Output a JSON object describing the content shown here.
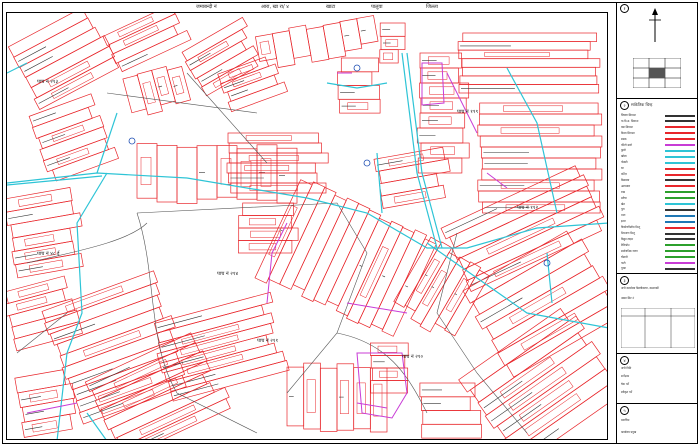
{
  "header": {
    "labels": [
      "जमाबन्दी नं",
      "आरा, खा रा/ ४",
      "खाटा",
      "पालुवा",
      "जिल्ला"
    ]
  },
  "map": {
    "labels": [
      {
        "text": "पाच नं ४८ ई"
      },
      {
        "text": "पाच नं २१४"
      },
      {
        "text": "पाच नं २११"
      },
      {
        "text": "पाच नं २१०"
      },
      {
        "text": "पाच नं ११२"
      },
      {
        "text": "पाच नं १९९"
      },
      {
        "text": "पाच नं २१३"
      }
    ],
    "colors": {
      "parcel": "#e8262b",
      "road": "#2ec4d6",
      "boundary": "#c83cd6",
      "line": "#555555"
    }
  },
  "panel": {
    "sections": [
      {
        "num": "१",
        "title": "उत्तर"
      },
      {
        "num": "२",
        "title": "सांकेतिक चिन्ह"
      },
      {
        "num": "३",
        "title": "नापी विवरण"
      },
      {
        "num": "४",
        "title": "प्रमाणित"
      },
      {
        "num": "५",
        "title": "मिति"
      }
    ],
    "legend": [
      {
        "label": "जिल्ला सिमाना",
        "color": "#333333"
      },
      {
        "label": "गा.वि.स. सिमाना",
        "color": "#333333"
      },
      {
        "label": "वडा सिमाना",
        "color": "#e8262b"
      },
      {
        "label": "कित्ता सिमाना",
        "color": "#e8262b"
      },
      {
        "label": "सडक",
        "color": "#e8262b"
      },
      {
        "label": "गोरेटो बाटो",
        "color": "#c83cd6"
      },
      {
        "label": "कुलो",
        "color": "#2ec4d6"
      },
      {
        "label": "खोला",
        "color": "#2ec4d6"
      },
      {
        "label": "पोखरी",
        "color": "#2ec4d6"
      },
      {
        "label": "घर",
        "color": "#e8262b"
      },
      {
        "label": "मन्दिर",
        "color": "#e8262b"
      },
      {
        "label": "विद्यालय",
        "color": "#333333"
      },
      {
        "label": "अस्पताल",
        "color": "#e8262b"
      },
      {
        "label": "रुख",
        "color": "#2ca02c"
      },
      {
        "label": "बगैचा",
        "color": "#2ca02c"
      },
      {
        "label": "खेत",
        "color": "#2ec4d6"
      },
      {
        "label": "पुल",
        "color": "#333333"
      },
      {
        "label": "धारा",
        "color": "#1f77b4"
      },
      {
        "label": "इनार",
        "color": "#1f77b4"
      },
      {
        "label": "त्रिकोणमितीय बिन्दु",
        "color": "#e8262b"
      },
      {
        "label": "नियन्त्रण बिन्दु",
        "color": "#333333"
      },
      {
        "label": "विद्युत लाइन",
        "color": "#333333"
      },
      {
        "label": "टेलिफोन",
        "color": "#2ca02c"
      },
      {
        "label": "सार्वजनिक जग्गा",
        "color": "#2ca02c"
      },
      {
        "label": "चौतारी",
        "color": "#2ca02c"
      },
      {
        "label": "पाटी",
        "color": "#c83cd6"
      },
      {
        "label": "गुम्बा",
        "color": "#333333"
      }
    ],
    "notes": [
      "नापी कार्यालय डिल्लीबजार, काठमाडौं",
      "नक्सा सिट नं",
      "नापी मिति",
      "सर्भेक्षक",
      "चेक गर्ने",
      "स्वीकृत गर्ने",
      "प्रमाणित",
      "कार्यालय प्रमुख"
    ]
  }
}
